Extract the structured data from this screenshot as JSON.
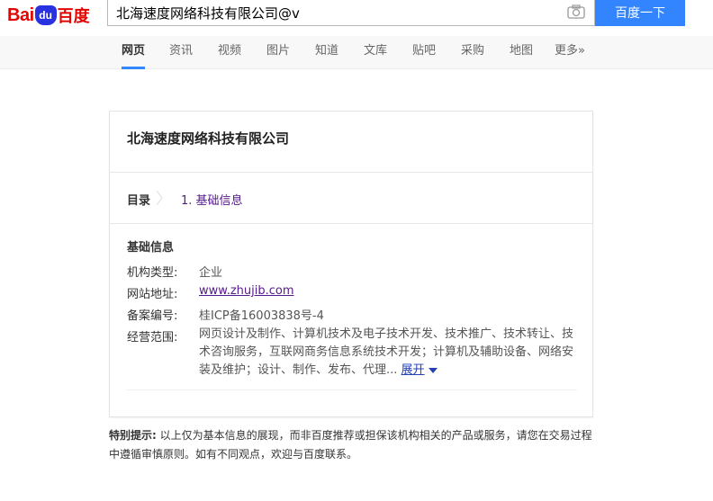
{
  "logo": {
    "bai": "Bai",
    "paw": "du",
    "du": "百度"
  },
  "search": {
    "value": "北海速度网络科技有限公司@v",
    "button": "百度一下"
  },
  "tabs": [
    "网页",
    "资讯",
    "视频",
    "图片",
    "知道",
    "文库",
    "贴吧",
    "采购",
    "地图",
    "更多»"
  ],
  "card": {
    "title": "北海速度网络科技有限公司",
    "toc_label": "目录",
    "toc_link": "1. 基础信息",
    "section_title": "基础信息",
    "rows": [
      {
        "label": "机构类型:",
        "value": "企业"
      },
      {
        "label": "网站地址:",
        "value": "www.zhujib.com"
      },
      {
        "label": "备案编号:",
        "value": "桂ICP备16003838号-4"
      },
      {
        "label": "经营范围:",
        "value": "网页设计及制作、计算机技术及电子技术开发、技术推广、技术转让、技术咨询服务，互联网商务信息系统技术开发；计算机及辅助设备、网络安装及维护；设计、制作、发布、代理..."
      }
    ],
    "expand": "展开"
  },
  "notice": {
    "bold": "特别提示:",
    "text": "以上仅为基本信息的展现，而非百度推荐或担保该机构相关的产品或服务，请您在交易过程中遵循审慎原则。如有不同观点，欢迎与百度联系。"
  },
  "colors": {
    "accent": "#3385ff",
    "brand_red": "#e10602",
    "brand_blue": "#2932e1",
    "visited_link": "#551a8b"
  }
}
